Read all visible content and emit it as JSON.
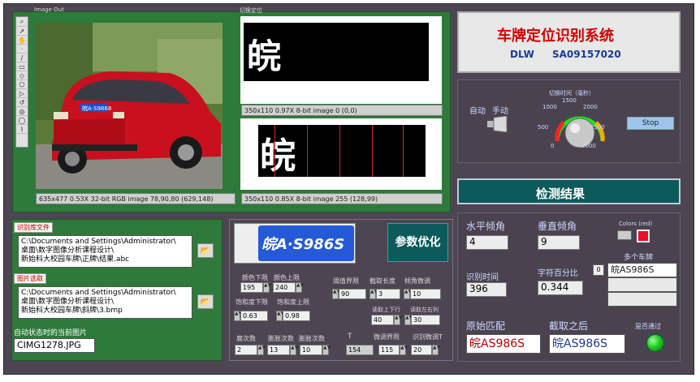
{
  "image_out": {
    "title": "Image Out",
    "tools": [
      "⌕",
      "➚",
      "✋",
      "⋯",
      "/",
      "▭",
      "⬠",
      "◇",
      "▷",
      "↺",
      "◯",
      "◯",
      "⌀"
    ],
    "status": "635x477 0.53X 32-bit RGB image 78,90,80    (629,148)",
    "car_plate": "皖A·S9868"
  },
  "locate": {
    "title": "切换定位",
    "plate_text": "皖A·S986S",
    "status_top": "350x110 0.97X 8-bit image 0    (0,0)",
    "status_bottom": "350x110 0.85X 8-bit image 255    (128,99)"
  },
  "header": {
    "title": "车牌定位识别系统",
    "author": "DLW",
    "id": "SA09157020"
  },
  "control": {
    "auto_label": "自动",
    "manual_label": "手动",
    "knob_title": "切换时间（毫秒）",
    "knob_ticks": [
      "0",
      "500",
      "1000",
      "1500",
      "2000",
      "2500",
      "3000"
    ],
    "stop_label": "Stop"
  },
  "library": {
    "label": "识别库文件",
    "path": "C:\\Documents and Settings\\Administrator\\\n桌面\\数字图像分析课程设计\\\n新始科大校园车牌\\正牌\\结果.abc"
  },
  "picture": {
    "label": "图片选取",
    "path": "C:\\Documents and Settings\\Administrator\\\n桌面\\数字图像分析课程设计\\\n新始科大校园车牌\\斜牌\\3.bmp",
    "current_label": "自动状态时的当前图片",
    "current_file": "CIMG1278.JPG"
  },
  "params": {
    "optimize_label": "参数优化",
    "plate_text": "皖A·S986S",
    "hue_low_label": "颜色下限",
    "hue_low": "195",
    "hue_high_label": "颜色上限",
    "hue_high": "240",
    "sat_low_label": "饱和度下限",
    "sat_low": "0.63",
    "sat_high_label": "饱和度上限",
    "sat_high": "0.98",
    "thresh_label": "阈值界限",
    "thresh": "90",
    "cut_len_label": "截取长度",
    "cut_len": "3",
    "angle_label": "倾角微调",
    "angle": "10",
    "updown_label": "读取上下行",
    "updown": "40",
    "leftright_label": "读取左右列",
    "leftright": "30",
    "corrode_label": "腐次数",
    "corrode": "2",
    "expand_label": "膨胀次数",
    "expand": "13",
    "dilate_label": "膨胀次数",
    "dilate": "10",
    "t_label": "T",
    "t_value": "154",
    "micro_label": "微调界限",
    "micro": "115",
    "recog_label": "识别微调T",
    "recog": "20"
  },
  "result": {
    "title": "检测结果",
    "h_angle_label": "水平倾角",
    "h_angle": "4",
    "v_angle_label": "垂直倾角",
    "v_angle": "9",
    "colors_label": "Colors (red)",
    "multi_label": "多个车牌",
    "multi_items": [
      "皖AS986S",
      "",
      ""
    ],
    "time_label": "识别时间",
    "time": "396",
    "percent_label": "字符百分比",
    "percent_idx": "0",
    "percent": "0.344",
    "orig_label": "原始匹配",
    "orig": "皖AS986S",
    "after_label": "截取之后",
    "after": "皖AS986S",
    "pass_label": "是否通过"
  },
  "colors": {
    "bg": "#4d4552",
    "green_panel": "#2d7a3a",
    "title_red": "#d40000",
    "title_blue": "#1a3a9a",
    "teal": "#0d5a5a",
    "led_green": "#22cc22"
  }
}
